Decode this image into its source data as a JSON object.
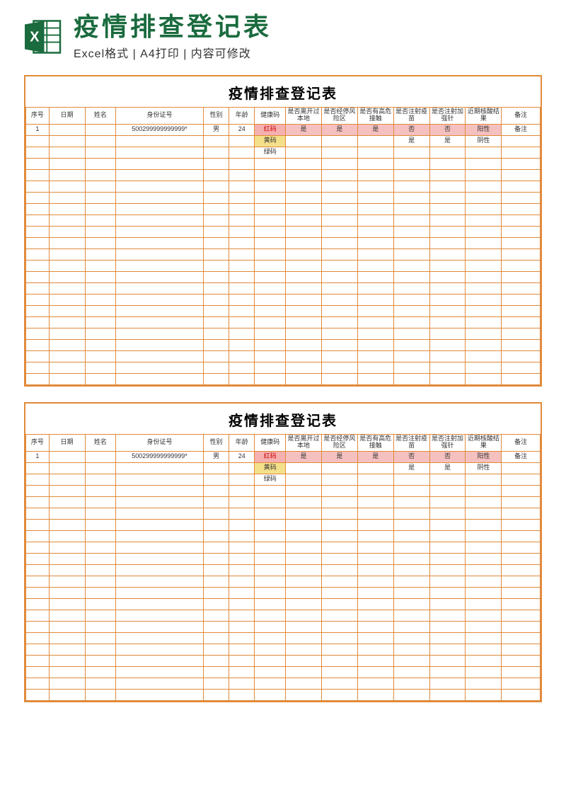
{
  "header": {
    "main_title": "疫情排查登记表",
    "sub_title": "Excel格式 | A4打印 | 内容可修改"
  },
  "sheet": {
    "title": "疫情排查登记表",
    "columns": {
      "seq": "序号",
      "date": "日期",
      "name": "姓名",
      "id": "身份证号",
      "sex": "性别",
      "age": "年龄",
      "code": "健康码",
      "leave": "是否离开过本地",
      "risk": "是否经停风险区",
      "contact": "是否有高危接触",
      "vacc": "是否注射疫苗",
      "boost": "是否注射加强针",
      "test": "近期核酸结果",
      "note": "备注"
    },
    "row1": {
      "seq": "1",
      "id": "500299999999999*",
      "sex": "男",
      "age": "24",
      "code": "红码",
      "leave": "是",
      "risk": "是",
      "contact": "是",
      "vacc": "否",
      "boost": "否",
      "test": "阳性",
      "note": "备注"
    },
    "row2": {
      "code": "黄码",
      "vacc": "是",
      "boost": "是",
      "test": "阴性"
    },
    "row3": {
      "code": "绿码"
    }
  }
}
